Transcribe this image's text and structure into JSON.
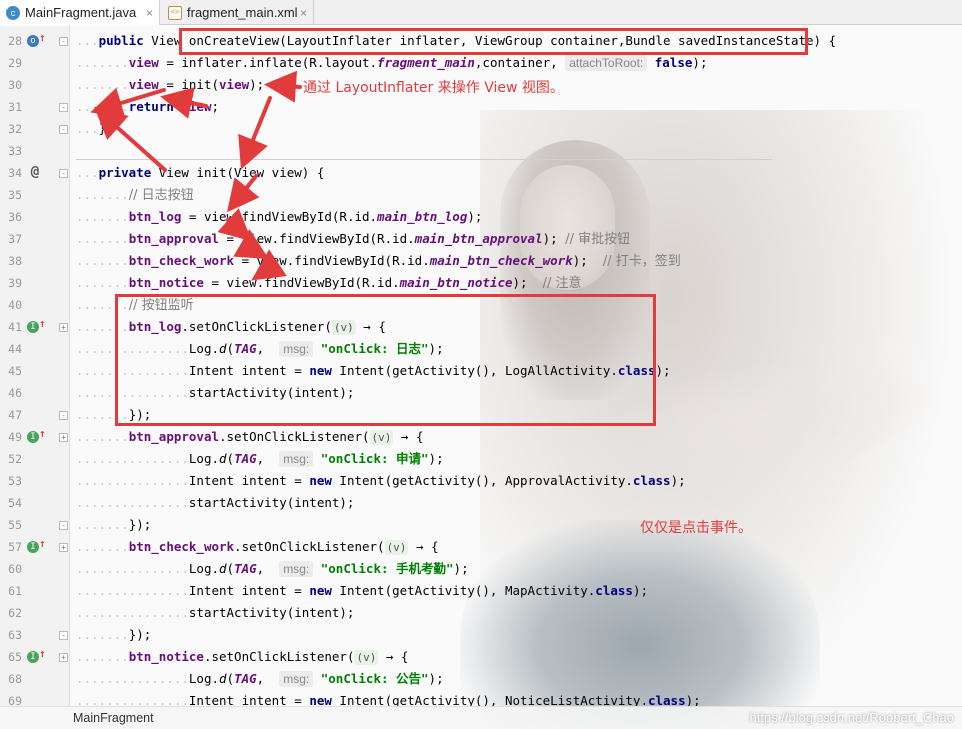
{
  "tabs": [
    {
      "label": "MainFragment.java",
      "icon": "java-class-icon",
      "active": true
    },
    {
      "label": "fragment_main.xml",
      "icon": "xml-file-icon",
      "active": false
    }
  ],
  "gutter": {
    "line_numbers": [
      "28",
      "29",
      "30",
      "31",
      "32",
      "33",
      "34",
      "35",
      "36",
      "37",
      "38",
      "39",
      "40",
      "41",
      "44",
      "45",
      "46",
      "47",
      "49",
      "52",
      "53",
      "54",
      "55",
      "57",
      "60",
      "61",
      "62",
      "63",
      "65",
      "68",
      "69"
    ]
  },
  "code": {
    "l28_sig_a": "public",
    "l28_sig_b": " View ",
    "l28_sig_c": "onCreateView(LayoutInflater inflater, ViewGroup container,Bundle savedInstanceState) {",
    "l29_a": "view",
    "l29_b": " = inflater.inflate(R.layout.",
    "l29_c": "fragment_main",
    "l29_d": ",container, ",
    "l29_hint": "attachToRoot:",
    "l29_e": "false",
    "l29_f": ");",
    "l30_a": "view",
    "l30_b": " = init(",
    "l30_c": "view",
    "l30_d": ");",
    "l31_a": "return",
    "l31_b": " view",
    "l31_c": ";",
    "l32": "}",
    "l34_a": "private",
    "l34_b": " View init(View view) {",
    "l35": "// 日志按钮",
    "l36_a": "btn_log",
    "l36_b": " = view.findViewById(R.id.",
    "l36_c": "main_btn_log",
    "l36_d": ");",
    "l37_a": "btn_approval",
    "l37_b": " = view.findViewById(R.id.",
    "l37_c": "main_btn_approval",
    "l37_d": "); ",
    "l37_e": "// 审批按钮",
    "l38_a": "btn_check_work",
    "l38_b": " = view.findViewById(R.id.",
    "l38_c": "main_btn_check_work",
    "l38_d": ");  ",
    "l38_e": "// 打卡，签到",
    "l39_a": "btn_notice",
    "l39_b": " = view.findViewById(R.id.",
    "l39_c": "main_btn_notice",
    "l39_d": ");  ",
    "l39_e": "// 注意",
    "l40": "// 按钮监听",
    "l41_a": "btn_log",
    "l41_b": ".setOnClickListener(",
    "l41_lam": "(v)",
    "l41_c": " → {",
    "l44_a": "Log.",
    "l44_b": "d",
    "l44_c": "(",
    "l44_d": "TAG",
    "l44_e": ",  ",
    "l44_hint": "msg:",
    "l44_f": " \"onClick: 日志\"",
    "l44_g": ");",
    "l45_a": "Intent intent = ",
    "l45_b": "new",
    "l45_c": " Intent(getActivity(), LogAllActivity.",
    "l45_d": "class",
    "l45_e": ");",
    "l46": "startActivity(intent);",
    "l47": "});",
    "l49_a": "btn_approval",
    "l49_b": ".setOnClickListener(",
    "l49_lam": "(v)",
    "l49_c": " → {",
    "l52_f": " \"onClick: 申请\"",
    "l53_c": " Intent(getActivity(), ApprovalActivity.",
    "l54": "startActivity(intent);",
    "l55": "});",
    "l57_a": "btn_check_work",
    "l57_b": ".setOnClickListener(",
    "l57_lam": "(v)",
    "l57_c": " → {",
    "l60_f": " \"onClick: 手机考勤\"",
    "l61_c": " Intent(getActivity(), MapActivity.",
    "l62": "startActivity(intent);",
    "l63": "});",
    "l65_a": "btn_notice",
    "l65_b": ".setOnClickListener(",
    "l65_lam": "(v)",
    "l65_c": " → {",
    "l68_f": " \"onClick: 公告\"",
    "l69_c": " Intent(getActivity(), NoticeListActivity.",
    "log": "Log.",
    "d": "d",
    "paren": "(",
    "tag": "TAG",
    "comma": ",  ",
    "msg": "msg:",
    "close": ");",
    "intent": "Intent intent = ",
    "new": "new",
    "class": "class"
  },
  "annotations": {
    "note1": "通过 LayoutInflater 来操作 View 视图。",
    "note2": "仅仅是点击事件。"
  },
  "status": {
    "breadcrumb": "MainFragment",
    "watermark": "https://blog.csdn.net/Roobert_Chao"
  },
  "colors": {
    "annotation": "#e23b3b",
    "keyword": "#000080",
    "field": "#660e7a",
    "string": "#008000"
  }
}
